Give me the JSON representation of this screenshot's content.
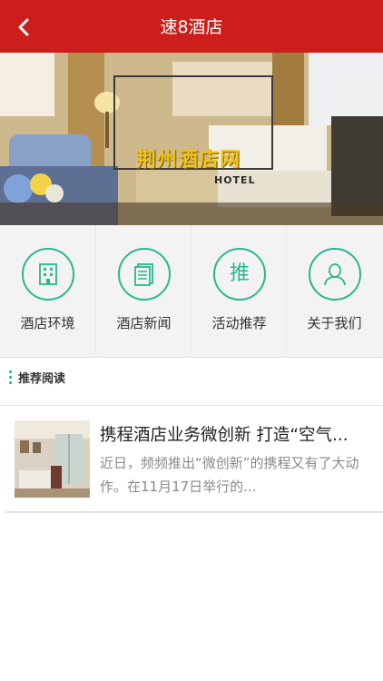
{
  "header": {
    "title": "速8酒店",
    "back_icon": "chevron-left-icon",
    "bg_color": "#cc1f1b"
  },
  "banner": {
    "logo_text": "荆州酒店网",
    "logo_sub": "HOTEL",
    "slide_count": 4,
    "active_slide": 1
  },
  "menu": {
    "accent_color": "#27b88e",
    "items": [
      {
        "label": "酒店环境",
        "icon": "building-icon"
      },
      {
        "label": "酒店新闻",
        "icon": "document-icon"
      },
      {
        "label": "活动推荐",
        "icon": "recommend-icon",
        "glyph": "推"
      },
      {
        "label": "关于我们",
        "icon": "person-icon"
      }
    ]
  },
  "section": {
    "title": "推荐阅读"
  },
  "articles": [
    {
      "title": "携程酒店业务微创新 打造“空气...",
      "desc": "近日，频频推出“微创新”的携程又有了大动作。在11月17日举行的..."
    }
  ]
}
